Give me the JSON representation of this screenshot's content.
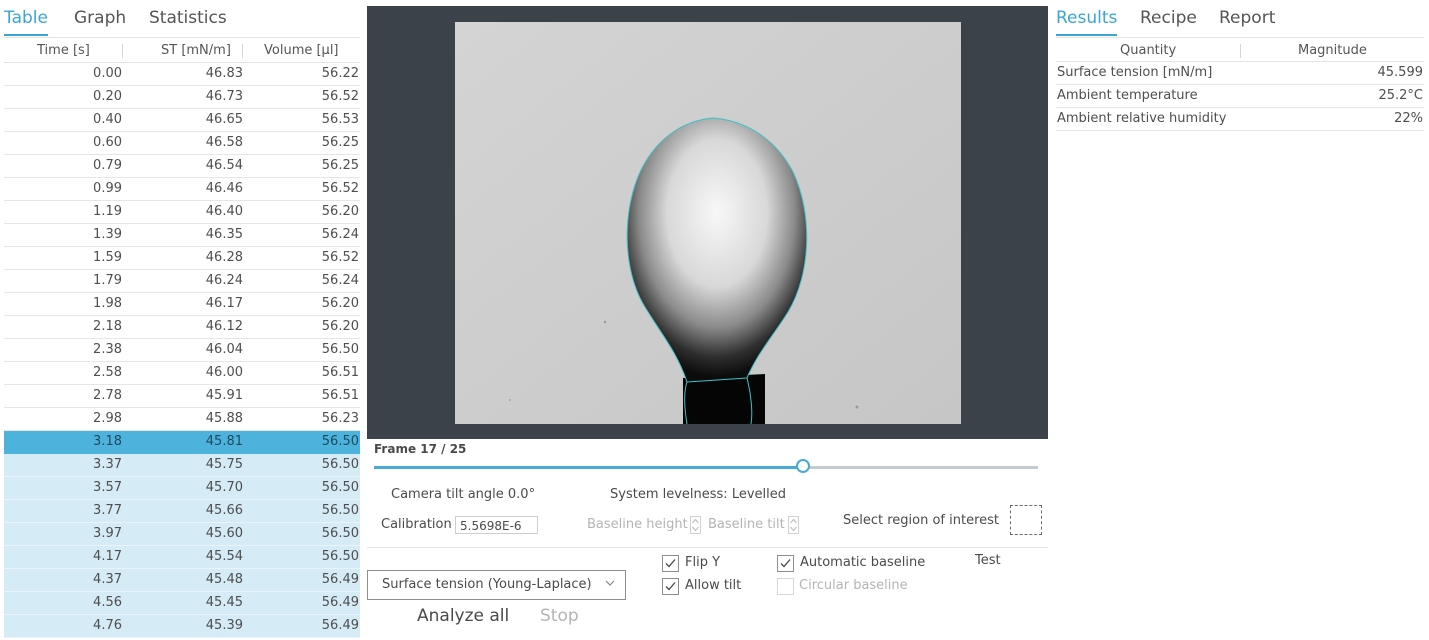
{
  "left": {
    "tabs": [
      "Table",
      "Graph",
      "Statistics"
    ],
    "headers": [
      "Time [s]",
      "ST [mN/m]",
      "Volume [µl]"
    ],
    "rows": [
      [
        "0.00",
        "46.83",
        "56.22"
      ],
      [
        "0.20",
        "46.73",
        "56.52"
      ],
      [
        "0.40",
        "46.65",
        "56.53"
      ],
      [
        "0.60",
        "46.58",
        "56.25"
      ],
      [
        "0.79",
        "46.54",
        "56.25"
      ],
      [
        "0.99",
        "46.46",
        "56.52"
      ],
      [
        "1.19",
        "46.40",
        "56.20"
      ],
      [
        "1.39",
        "46.35",
        "56.24"
      ],
      [
        "1.59",
        "46.28",
        "56.52"
      ],
      [
        "1.79",
        "46.24",
        "56.24"
      ],
      [
        "1.98",
        "46.17",
        "56.20"
      ],
      [
        "2.18",
        "46.12",
        "56.20"
      ],
      [
        "2.38",
        "46.04",
        "56.50"
      ],
      [
        "2.58",
        "46.00",
        "56.51"
      ],
      [
        "2.78",
        "45.91",
        "56.51"
      ],
      [
        "2.98",
        "45.88",
        "56.23"
      ],
      [
        "3.18",
        "45.81",
        "56.50"
      ],
      [
        "3.37",
        "45.75",
        "56.50"
      ],
      [
        "3.57",
        "45.70",
        "56.50"
      ],
      [
        "3.77",
        "45.66",
        "56.50"
      ],
      [
        "3.97",
        "45.60",
        "56.50"
      ],
      [
        "4.17",
        "45.54",
        "56.50"
      ],
      [
        "4.37",
        "45.48",
        "56.49"
      ],
      [
        "4.56",
        "45.45",
        "56.49"
      ],
      [
        "4.76",
        "45.39",
        "56.49"
      ]
    ],
    "selected_index": 16
  },
  "center": {
    "frame_label": "Frame 17 / 25",
    "frame_current": 17,
    "frame_total": 25,
    "camera_tilt": "Camera tilt angle 0.0°",
    "system_levelness": "System levelness: Levelled",
    "calibration_label": "Calibration",
    "calibration_value": "5.5698E-6",
    "baseline_height_label": "Baseline height",
    "baseline_tilt_label": "Baseline tilt",
    "roi_label": "Select region of interest",
    "method_selected": "Surface tension (Young-Laplace)",
    "checkboxes": {
      "flip_y": {
        "label": "Flip Y",
        "checked": true
      },
      "allow_tilt": {
        "label": "Allow tilt",
        "checked": true
      },
      "automatic_baseline": {
        "label": "Automatic baseline",
        "checked": true
      },
      "circular_baseline": {
        "label": "Circular baseline",
        "checked": false
      }
    },
    "test_label": "Test",
    "analyze_all_label": "Analyze all",
    "stop_label": "Stop"
  },
  "right": {
    "tabs": [
      "Results",
      "Recipe",
      "Report"
    ],
    "headers": [
      "Quantity",
      "Magnitude"
    ],
    "rows": [
      {
        "quantity": "Surface tension [mN/m]",
        "magnitude": "45.599"
      },
      {
        "quantity": "Ambient temperature",
        "magnitude": "25.2°C"
      },
      {
        "quantity": "Ambient relative humidity",
        "magnitude": "22%"
      }
    ]
  },
  "colors": {
    "accent": "#39a5d6",
    "selected_row": "#4db3dd",
    "subsequent_rows": "#d5ebf6",
    "viewer_bg": "#3c4249",
    "drop_contour": "#3fc0c8"
  }
}
